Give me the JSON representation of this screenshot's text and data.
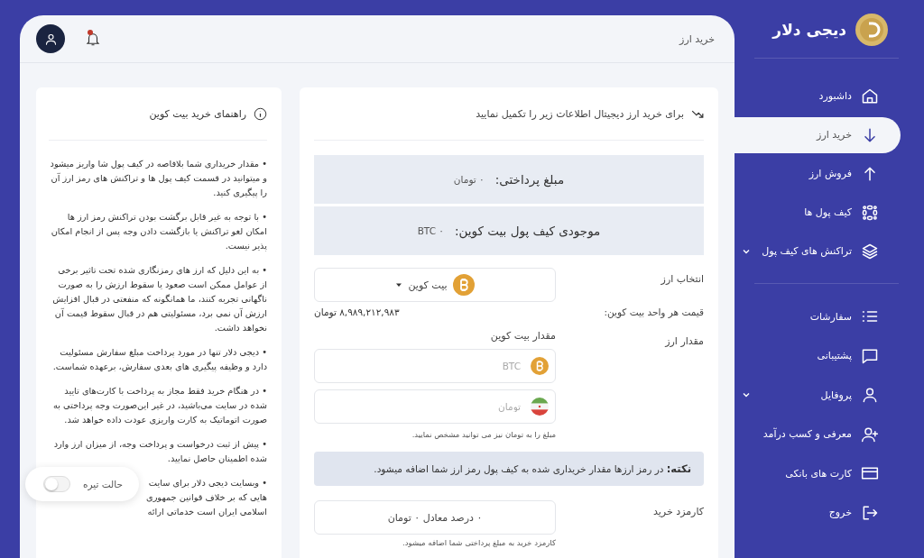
{
  "sidebar": {
    "logo": "دیجی دلار",
    "groups": [
      {
        "items": [
          {
            "label": "داشبورد",
            "selected": false,
            "expandable": false
          },
          {
            "label": "خرید ارز",
            "selected": true,
            "expandable": false
          },
          {
            "label": "فروش ارز",
            "selected": false,
            "expandable": false
          },
          {
            "label": "کیف پول ها",
            "selected": false,
            "expandable": false
          },
          {
            "label": "تراکنش های کیف پول",
            "selected": false,
            "expandable": true
          }
        ]
      },
      {
        "items": [
          {
            "label": "سفارشات",
            "selected": false,
            "expandable": false
          },
          {
            "label": "پشتیبانی",
            "selected": false,
            "expandable": false
          },
          {
            "label": "پروفایل",
            "selected": false,
            "expandable": true
          },
          {
            "label": "معرفی و کسب درآمد",
            "selected": false,
            "expandable": false
          },
          {
            "label": "کارت های بانکی",
            "selected": false,
            "expandable": false
          },
          {
            "label": "خروج",
            "selected": false,
            "expandable": false
          }
        ]
      }
    ]
  },
  "header": {
    "title": "خرید ارز",
    "has_notification": true
  },
  "form": {
    "intro": "برای خرید ارز دیجیتال اطلاعات زیر را تکمیل نمایید",
    "summary": [
      {
        "label": "مبلغ پرداختی:",
        "value": "۰ تومان"
      },
      {
        "label": "موجودی کیف پول بیت کوین:",
        "value": "۰ BTC"
      }
    ],
    "currency": {
      "label": "انتخاب ارز",
      "value": "بیت کوین",
      "price_label": "قیمت هر واحد بیت کوین:",
      "price": "۸,۹۸۹,۲۱۲,۹۸۳ تومان"
    },
    "amount": {
      "label": "مقدار ارز",
      "sublabel": "مقدار بیت کوین",
      "inputs": [
        {
          "kind": "crypto",
          "placeholder": "BTC"
        },
        {
          "kind": "fiat",
          "placeholder": "تومان"
        }
      ],
      "hint": "مبلغ را به تومان نیز می توانید مشخص نمایید."
    },
    "note": "**نکته:** در رمز ارزها مقدار خریداری شده به کیف پول رمز ارز شما اضافه میشود.",
    "fee": {
      "label": "کارمزد خرید",
      "value": "۰ درصد معادل ۰ تومان",
      "hint": "کارمزد خرید به مبلغ پرداختی شما اضافه میشود."
    }
  },
  "help": {
    "title": "راهنمای خرید بیت کوین",
    "items": [
      "•  مقدار خریداری شما بلافاصه در کیف پول شا واریز میشود و میتوانید در قسمت کیف پول ها و تراکنش های رمز ارز آن را پیگیری کنید.",
      "•  با توجه به غیر قابل برگشت بودن تراکنش رمز ارز ها امکان لغو تراکنش یا بازگشت دادن وجه پس از انجام امکان پذیر نیست.",
      "•  به این دلیل که ارز های رمزنگاری شده تحت تاثیر برخی از عوامل ممکن است صعود یا سقوط ارزش را به صورت ناگهانی تجربه کنند، ما همانگونه که منفعتی در قبال افزایش ارزش آن نمی برد، مسئولیتی هم در قبال سقوط قیمت آن نخواهد داشت.",
      "•  دیجی دلار تنها در مورد پرداخت مبلغ سفارش مسئولیت دارد و وظیفه پیگیری های بعدی سفارش، برعهده شماست.",
      "•  در هنگام خرید فقط مجاز به پرداخت با کارت‌های تایید شده در سایت می‌باشید، در غیر این‌صورت وجه پرداختی به صورت اتوماتیک به کارت واریزی عودت داده خواهد شد.",
      "•  پیش از ثبت درخواست و پرداخت وجه، از میزان ارز وارد شده اطمینان حاصل نمایید.",
      "•  وبسایت دیجی دلار برای سایت هایی که بر خلاف قوانین جمهوری اسلامی ایران است خدماتی ارائه"
    ]
  },
  "dark_mode": {
    "label": "حالت تیره",
    "on": false
  }
}
